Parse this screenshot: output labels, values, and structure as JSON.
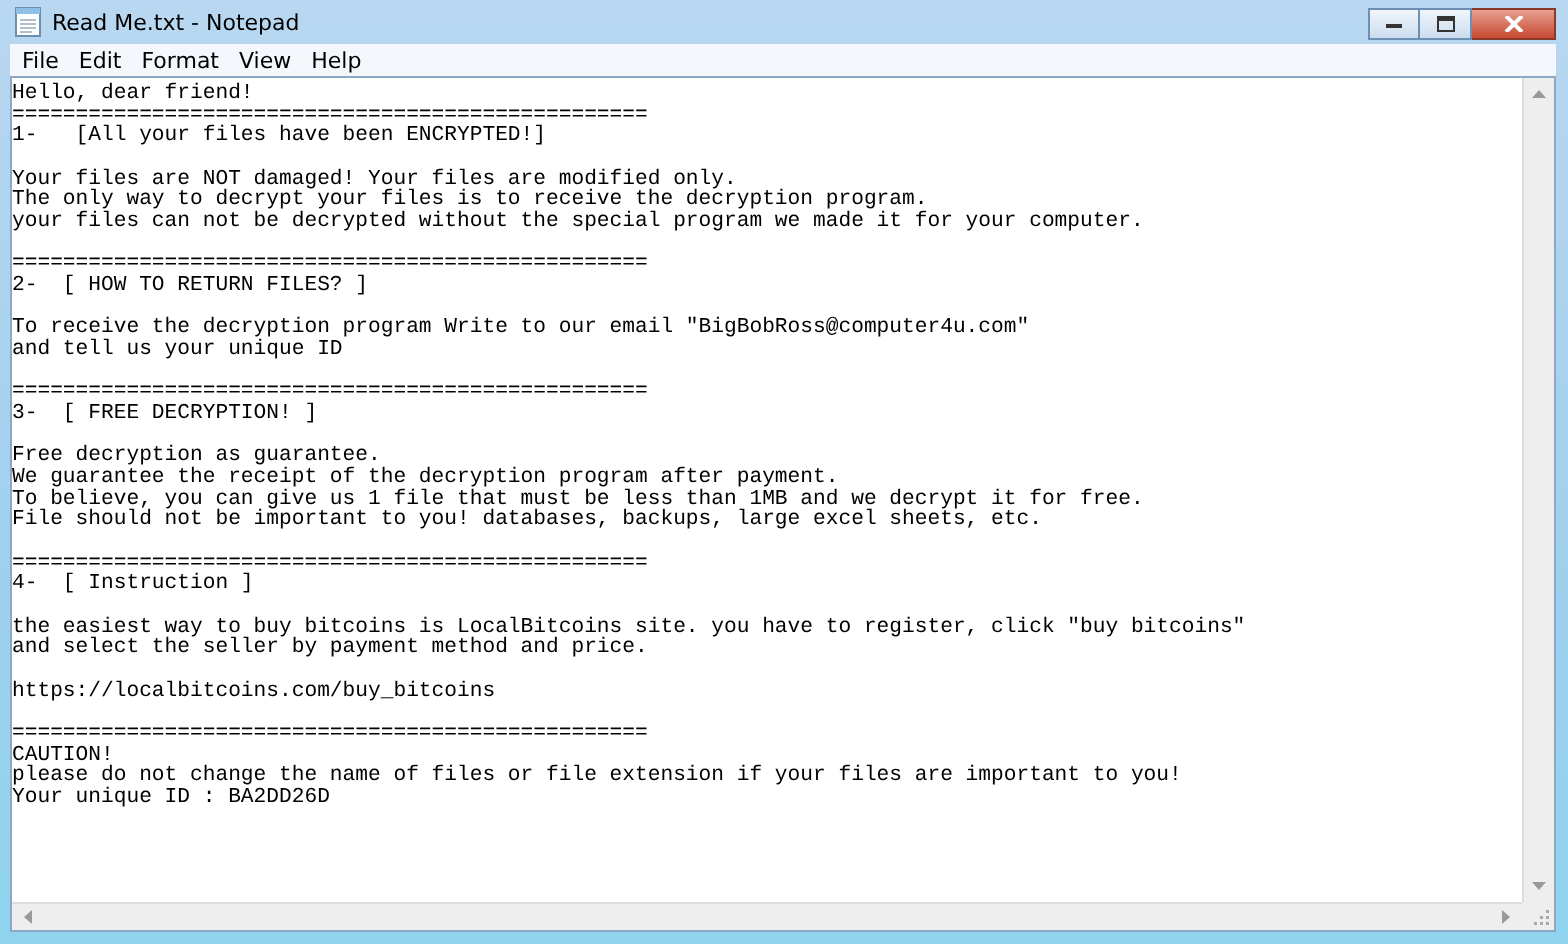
{
  "window": {
    "title": "Read Me.txt - Notepad"
  },
  "menu": [
    "File",
    "Edit",
    "Format",
    "View",
    "Help"
  ],
  "document": {
    "blocks": [
      {
        "lines": [
          "Hello, dear friend!",
          "==================================================",
          "1-   [All your files have been ENCRYPTED!]"
        ]
      },
      {
        "lines": [
          "Your files are NOT damaged! Your files are modified only.",
          "The only way to decrypt your files is to receive the decryption program.",
          "your files can not be decrypted without the special program we made it for your computer."
        ]
      },
      {
        "lines": [
          "==================================================",
          "2-  [ HOW TO RETURN FILES? ]"
        ]
      },
      {
        "lines": [
          "To receive the decryption program Write to our email \"BigBobRoss@computer4u.com\"",
          "and tell us your unique ID"
        ]
      },
      {
        "lines": [
          "==================================================",
          "3-  [ FREE DECRYPTION! ]"
        ]
      },
      {
        "lines": [
          "Free decryption as guarantee.",
          "We guarantee the receipt of the decryption program after payment.",
          "To believe, you can give us 1 file that must be less than 1MB and we decrypt it for free.",
          "File should not be important to you! databases, backups, large excel sheets, etc."
        ]
      },
      {
        "lines": [
          "==================================================",
          "4-  [ Instruction ]"
        ]
      },
      {
        "lines": [
          "the easiest way to buy bitcoins is LocalBitcoins site. you have to register, click \"buy bitcoins\"",
          "and select the seller by payment method and price."
        ]
      },
      {
        "lines": [
          "https://localbitcoins.com/buy_bitcoins"
        ]
      },
      {
        "lines": [
          "==================================================",
          "CAUTION!",
          "please do not change the name of files or file extension if your files are important to you!",
          "Your unique ID : BA2DD26D"
        ]
      }
    ]
  }
}
